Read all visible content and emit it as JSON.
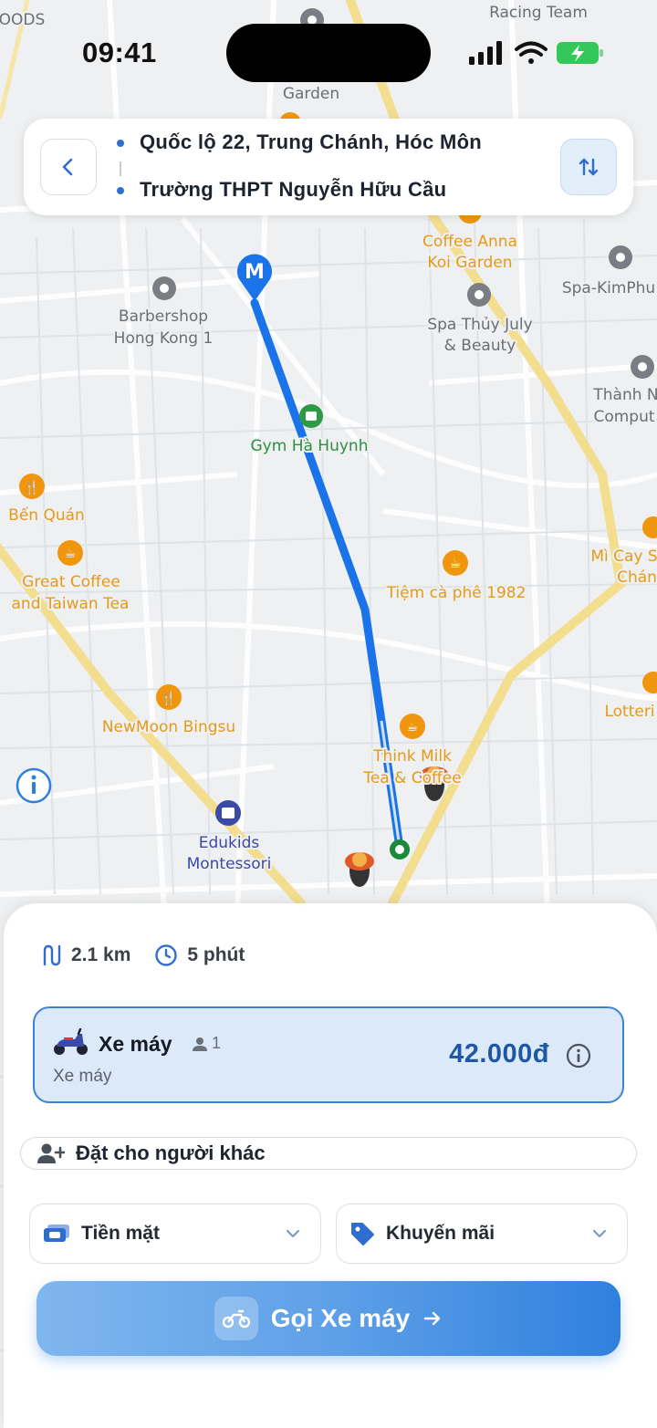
{
  "status_bar": {
    "time": "09:41"
  },
  "map": {
    "labels": {
      "top_left_partial": "OODS",
      "racing_team": "Racing Team",
      "garden": "Garden",
      "coffee_anna_1": "Coffee Anna",
      "coffee_anna_2": "Koi Garden",
      "spa_kimphu": "Spa-KimPhu",
      "spa_thuy_1": "Spa Thủy July",
      "spa_thuy_2": "& Beauty",
      "barbershop_1": "Barbershop",
      "barbershop_2": "Hong Kong 1",
      "thanh_1": "Thành N",
      "thanh_2": "Comput",
      "gym": "Gym Hà Huynh",
      "ben_quan": "Bến Quán",
      "great_coffee_1": "Great Coffee",
      "great_coffee_2": "and Taiwan Tea",
      "tiem_ca_phe": "Tiệm cà phê 1982",
      "mi_cay_1": "Mì Cay S",
      "mi_cay_2": "Chán",
      "newmoon": "NewMoon Bingsu",
      "lotteri": "Lotteri",
      "think_milk_1": "Think Milk",
      "think_milk_2": "Tea & Coffee",
      "edukids_1": "Edukids",
      "edukids_2": "Montessori"
    },
    "route_color": "#1a73e8"
  },
  "route": {
    "origin": "Quốc lộ 22, Trung Chánh, Hóc Môn",
    "destination": "Trường THPT Nguyễn Hữu Cầu"
  },
  "trip": {
    "distance": "2.1 km",
    "duration": "5 phút"
  },
  "vehicle": {
    "name": "Xe máy",
    "seats": "1",
    "subtitle": "Xe máy",
    "price": "42.000đ"
  },
  "book_for_other": "Đặt cho người khác",
  "payment": {
    "label": "Tiền mặt"
  },
  "promo": {
    "label": "Khuyến mãi"
  },
  "cta": {
    "label": "Gọi Xe máy"
  },
  "colors": {
    "accent": "#2f80de",
    "price": "#1d57a6",
    "card_bg": "#dbe9f8"
  }
}
